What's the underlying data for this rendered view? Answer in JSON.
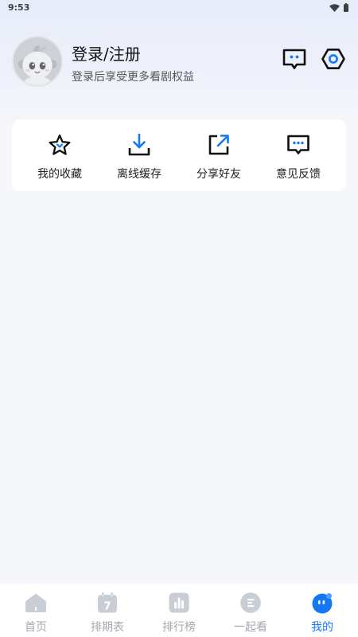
{
  "status_bar": {
    "time": "9:53",
    "icons": [
      "wifi-icon",
      "battery-icon"
    ]
  },
  "profile": {
    "title": "登录/注册",
    "subtitle": "登录后享受更多看剧权益",
    "avatar_icon": "default-avatar-icon"
  },
  "header_actions": [
    {
      "icon": "message-icon"
    },
    {
      "icon": "gear-icon"
    }
  ],
  "quick_actions": [
    {
      "label": "我的收藏",
      "icon": "star-icon"
    },
    {
      "label": "离线缓存",
      "icon": "download-icon"
    },
    {
      "label": "分享好友",
      "icon": "share-icon"
    },
    {
      "label": "意见反馈",
      "icon": "feedback-icon"
    }
  ],
  "tab_bar": {
    "tabs": [
      {
        "label": "首页",
        "icon": "home-icon",
        "active": false
      },
      {
        "label": "排期表",
        "icon": "calendar-icon",
        "icon_text": "7",
        "active": false
      },
      {
        "label": "排行榜",
        "icon": "bar-chart-icon",
        "active": false
      },
      {
        "label": "一起看",
        "icon": "watch-together-icon",
        "active": false
      },
      {
        "label": "我的",
        "icon": "profile-face-icon",
        "active": true
      }
    ]
  },
  "colors": {
    "accent": "#1677f5",
    "page_background": "#f5f7fa",
    "tab_inactive": "#a3a8b1",
    "icon_inactive": "#c9cdd6",
    "text_primary": "#111111",
    "text_secondary": "#555555"
  }
}
